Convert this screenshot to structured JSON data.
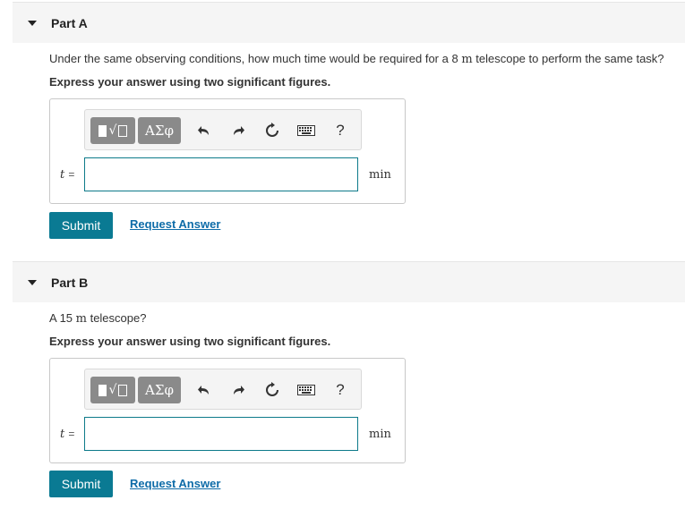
{
  "parts": [
    {
      "title": "Part A",
      "question_pre": "Under the same observing conditions, how much time would be required for a 8 ",
      "question_unit": "m",
      "question_post": " telescope to perform the same task?",
      "instruction": "Express your answer using two significant figures.",
      "variable": "t",
      "equals": "=",
      "input_value": "",
      "unit": "min",
      "submit_label": "Submit",
      "request_label": "Request Answer"
    },
    {
      "title": "Part B",
      "question_pre": "A 15 ",
      "question_unit": "m",
      "question_post": " telescope?",
      "instruction": "Express your answer using two significant figures.",
      "variable": "t",
      "equals": "=",
      "input_value": "",
      "unit": "min",
      "submit_label": "Submit",
      "request_label": "Request Answer"
    }
  ],
  "toolbar": {
    "templates_label": "√",
    "greek_label": "ΑΣφ",
    "undo_icon": "undo-arrow-icon",
    "redo_icon": "redo-arrow-icon",
    "reset_icon": "reset-icon",
    "keyboard_icon": "keyboard-icon",
    "help_label": "?"
  },
  "colors": {
    "accent": "#0a7a93",
    "link": "#0e6ca8",
    "input_border": "#0d7a8a",
    "toolbar_button": "#8a8a8a",
    "header_bg": "#f5f5f5"
  }
}
